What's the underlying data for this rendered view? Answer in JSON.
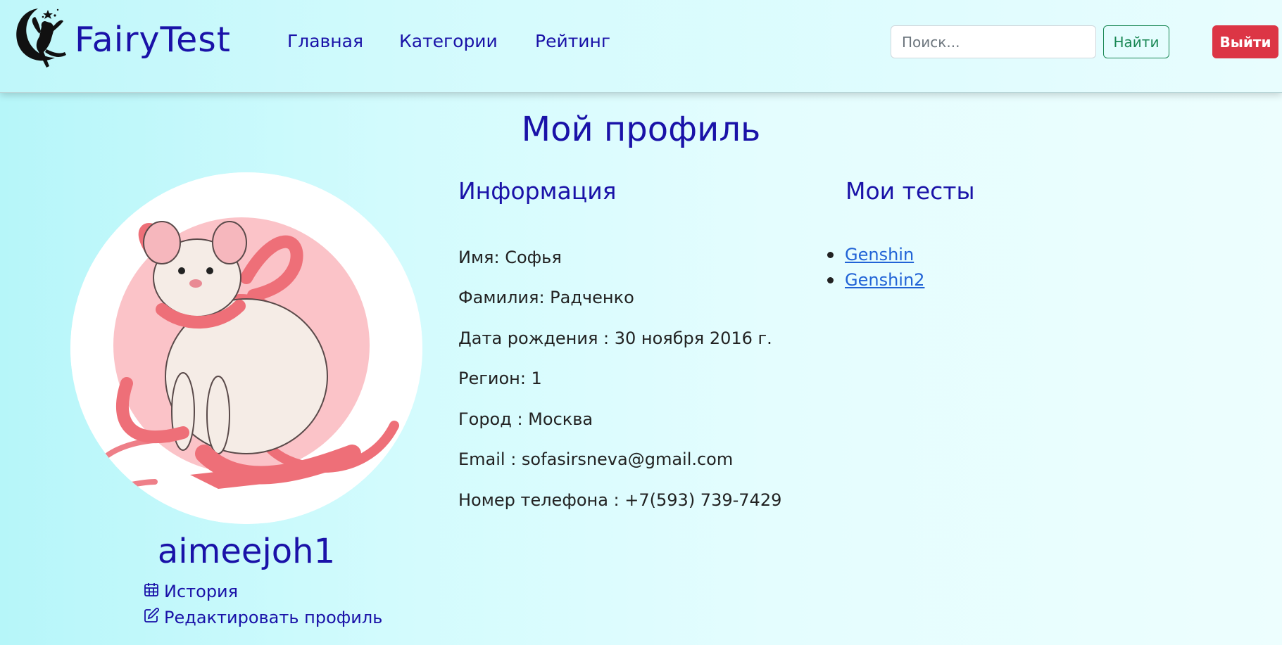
{
  "brand": {
    "name": "FairyTest",
    "logo_icon": "fairy-moon-icon"
  },
  "nav": {
    "items": [
      {
        "label": "Главная"
      },
      {
        "label": "Категории"
      },
      {
        "label": "Рейтинг"
      }
    ]
  },
  "search": {
    "placeholder": "Поиск...",
    "button_label": "Найти"
  },
  "logout": {
    "label": "Выйти"
  },
  "colors": {
    "accent": "#1a12a8",
    "success": "#198754",
    "danger": "#dc3545",
    "link": "#2163d6"
  },
  "profile": {
    "title": "Мой профиль",
    "username": "aimeejoh1",
    "avatar_icon": "rat-with-ribbon-avatar",
    "history_label": "История",
    "history_icon": "calendar-icon",
    "edit_label": "Редактировать профиль",
    "edit_icon": "edit-icon"
  },
  "info": {
    "title": "Информация",
    "rows": [
      {
        "text": "Имя: Софья"
      },
      {
        "text": "Фамилия: Радченко"
      },
      {
        "text": "Дата рождения : 30 ноября 2016 г."
      },
      {
        "text": "Регион: 1"
      },
      {
        "text": "Город : Москва"
      },
      {
        "text": "Email : sofasirsneva@gmail.com"
      },
      {
        "text": "Номер телефона : +7(593) 739-7429"
      }
    ]
  },
  "tests": {
    "title": "Мои тесты",
    "items": [
      {
        "label": "Genshin"
      },
      {
        "label": "Genshin2"
      }
    ]
  }
}
